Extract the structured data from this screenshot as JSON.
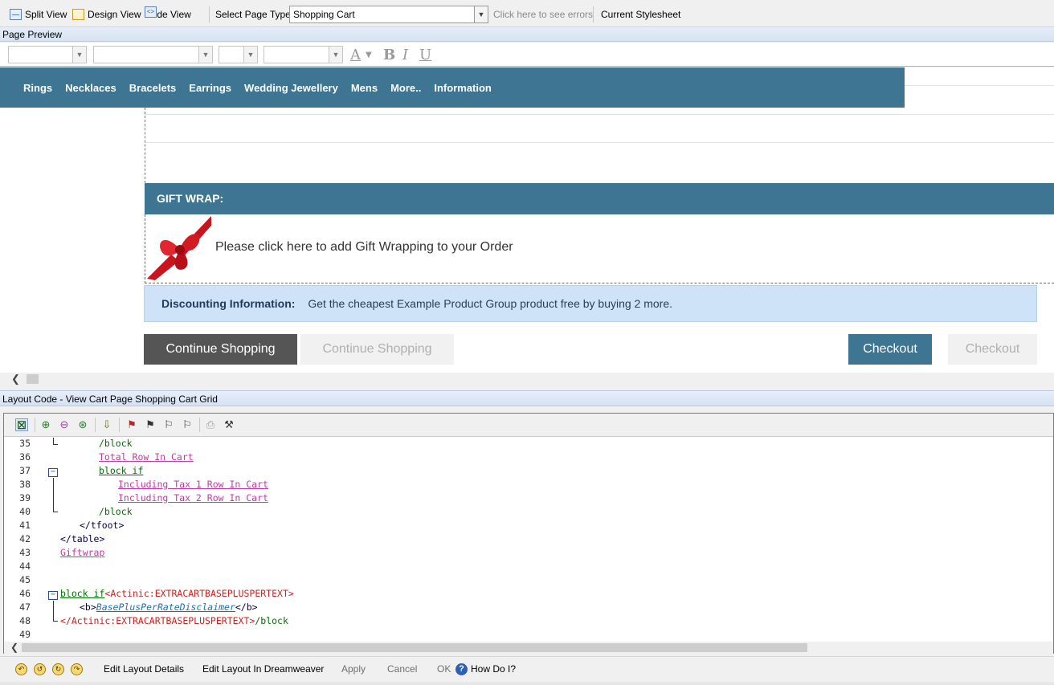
{
  "toolbar": {
    "split_view": "Split View",
    "design_view": "Design View",
    "code_view": "Code View",
    "select_page_type_label": "Select Page Type",
    "page_type_value": "Shopping Cart",
    "errors_link": "Click here to see errors",
    "current_stylesheet": "Current Stylesheet"
  },
  "preview_panel": {
    "title": "Page Preview"
  },
  "format_toolbar": {
    "bold": "B",
    "italic": "I",
    "underline": "U",
    "font_color": "A"
  },
  "preview": {
    "nav_items": [
      "Rings",
      "Necklaces",
      "Bracelets",
      "Earrings",
      "Wedding Jewellery",
      "Mens",
      "More..",
      "Information"
    ],
    "giftwrap_title": "GIFT WRAP:",
    "giftwrap_text": "Please click here to add Gift Wrapping to your Order",
    "discount_title": "Discounting Information:",
    "discount_text": "Get the cheapest Example Product Group product free by buying 2 more.",
    "continue_shopping_1": "Continue Shopping",
    "continue_shopping_2": "Continue Shopping",
    "checkout_1": "Checkout",
    "checkout_2": "Checkout",
    "colors": {
      "brand": "#3e7593",
      "discount_bg": "#cfe3f8",
      "dark_button": "#555555"
    }
  },
  "layout_panel": {
    "title": "Layout Code  - View Cart Page Shopping Cart Grid"
  },
  "code": {
    "lines": [
      {
        "n": "35",
        "parts": [
          {
            "t": "/block",
            "c": "c-green"
          }
        ]
      },
      {
        "n": "36",
        "parts": [
          {
            "t": "Total Row In Cart",
            "c": "c-link"
          }
        ]
      },
      {
        "n": "37",
        "parts": [
          {
            "t": "block if",
            "c": "c-link-green"
          }
        ]
      },
      {
        "n": "38",
        "parts": [
          {
            "t": "Including Tax 1 Row In Cart",
            "c": "c-link"
          }
        ]
      },
      {
        "n": "39",
        "parts": [
          {
            "t": "Including Tax 2 Row In Cart",
            "c": "c-link"
          }
        ]
      },
      {
        "n": "40",
        "parts": [
          {
            "t": "/block",
            "c": "c-green"
          }
        ]
      },
      {
        "n": "41",
        "parts": [
          {
            "t": "</tfoot>",
            "c": "c-navy"
          }
        ]
      },
      {
        "n": "42",
        "parts": [
          {
            "t": "</table>",
            "c": "c-navy"
          }
        ]
      },
      {
        "n": "43",
        "parts": [
          {
            "t": "Giftwrap",
            "c": "c-link"
          }
        ]
      },
      {
        "n": "44",
        "parts": []
      },
      {
        "n": "45",
        "parts": []
      },
      {
        "n": "46",
        "parts": [
          {
            "t": "block if",
            "c": "c-link-green"
          },
          {
            "t": "<Actinic:EXTRACARTBASEPLUSPERTEXT>",
            "c": "c-red"
          }
        ]
      },
      {
        "n": "47",
        "parts": [
          {
            "t": "<b>",
            "c": "c-navy"
          },
          {
            "t": "BasePlusPerRateDisclaimer",
            "c": "c-blue-link"
          },
          {
            "t": "</b>",
            "c": "c-navy"
          }
        ]
      },
      {
        "n": "48",
        "parts": [
          {
            "t": "</Actinic:EXTRACARTBASEPLUSPERTEXT>",
            "c": "c-red"
          },
          {
            "t": "/block",
            "c": "c-green"
          }
        ]
      },
      {
        "n": "49",
        "parts": []
      }
    ]
  },
  "bottombar": {
    "edit_layout_details": "Edit Layout Details",
    "edit_in_dreamweaver": "Edit Layout In Dreamweaver",
    "apply": "Apply",
    "cancel": "Cancel",
    "ok": "OK",
    "how_do_i": "How Do I?"
  }
}
